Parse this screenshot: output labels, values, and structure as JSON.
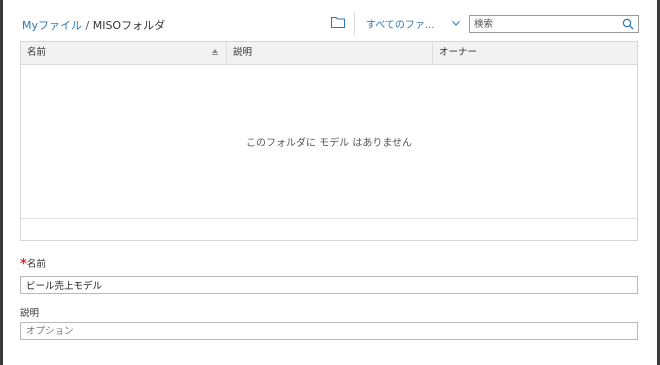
{
  "breadcrumb": {
    "root": "Myファイル",
    "separator": " / ",
    "current": "MISOフォルダ"
  },
  "toolbar": {
    "new_folder_icon": "folder-icon",
    "filter_label": "すべてのファ...",
    "search_placeholder": "検索"
  },
  "table": {
    "columns": [
      {
        "label": "名前",
        "sorted": "ascending"
      },
      {
        "label": "説明"
      },
      {
        "label": "オーナー"
      }
    ],
    "rows": [],
    "empty_message": "このフォルダに モデル はありません"
  },
  "form": {
    "name": {
      "required_mark": "*",
      "label": "名前",
      "value": "ビール売上モデル"
    },
    "description": {
      "label": "説明",
      "placeholder": "オプション",
      "value": ""
    }
  },
  "colors": {
    "link": "#2a7ab8",
    "required": "#d9292f",
    "header_bg": "#f2f2f2"
  }
}
